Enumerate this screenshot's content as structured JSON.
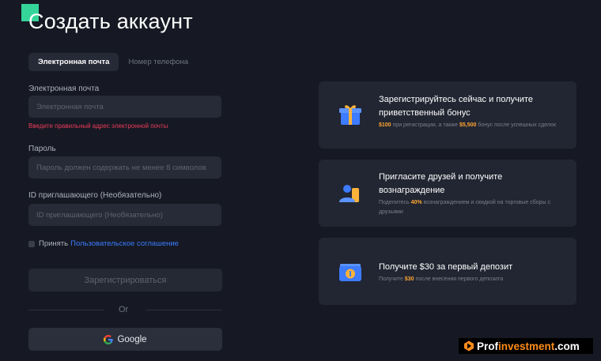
{
  "page": {
    "title": "Создать аккаунт"
  },
  "tabs": [
    {
      "label": "Электронная почта",
      "active": true
    },
    {
      "label": "Номер телефона",
      "active": false
    }
  ],
  "form": {
    "email_label": "Электронная почта",
    "email_placeholder": "Электронная почта",
    "email_error": "Введите правильный адрес электронной почты",
    "password_label": "Пароль",
    "password_placeholder": "Пароль должен содержать не менее 8 символов",
    "referral_label": "ID приглашающего (Необязательно)",
    "referral_placeholder": "ID приглашающего (Необязательно)",
    "agree_text": "Принять",
    "agree_link": "Пользовательское соглашение",
    "register_button": "Зарегистрироваться",
    "or_text": "Or",
    "google_button": "Google"
  },
  "promos": [
    {
      "icon": "gift-icon",
      "title": "Зарегистрируйтесь сейчас и получите приветственный бонус",
      "desc_amount1": "$100",
      "desc_part1": " при регистрации, а также ",
      "desc_amount2": "$5,500",
      "desc_part2": " бонус после успешных сделок"
    },
    {
      "icon": "users-icon",
      "title": "Пригласите друзей и получите вознаграждение",
      "desc_part0": "Поделитесь ",
      "desc_amount1": "40%",
      "desc_part1": " вознаграждением и скидкой на торговые сборы с друзьями"
    },
    {
      "icon": "wallet-icon",
      "title": "Получите $30 за первый депозит",
      "desc_part0": "Получите ",
      "desc_amount1": "$30",
      "desc_part1": " после внесения первого депозита"
    }
  ],
  "watermark": {
    "prefix": "Prof",
    "accent": "investment",
    "suffix": ".com"
  },
  "colors": {
    "background": "#161923",
    "accent_green": "#35d59a",
    "link_blue": "#3a7bff",
    "error_red": "#ec3b5a",
    "highlight_orange": "#ffa632"
  }
}
